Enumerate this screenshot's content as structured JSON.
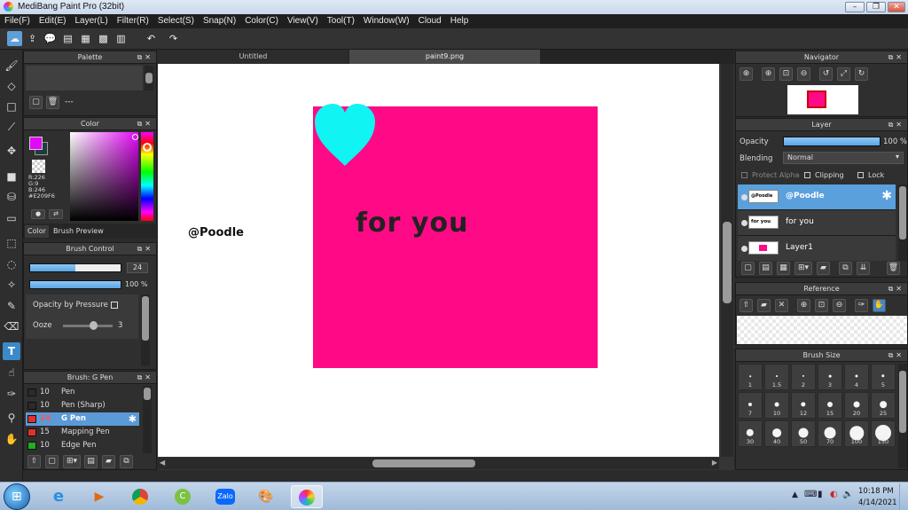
{
  "window": {
    "title": "MediBang Paint Pro (32bit)",
    "min": "–",
    "restore": "❐",
    "close": "✕"
  },
  "menu": [
    "File(F)",
    "Edit(E)",
    "Layer(L)",
    "Filter(R)",
    "Select(S)",
    "Snap(N)",
    "Color(C)",
    "View(V)",
    "Tool(T)",
    "Window(W)",
    "Cloud",
    "Help"
  ],
  "toolbar_icons": [
    "cloud-icon",
    "share-icon",
    "chat-icon",
    "comment-icon",
    "document-icon",
    "grid-icon",
    "layout-icon",
    "undo-icon",
    "redo-icon"
  ],
  "tools": [
    "brush",
    "eraser",
    "dot-square",
    "brush-stroke",
    "move",
    "fill-rect",
    "bucket",
    "gradient",
    "select-rect",
    "lasso",
    "magic-wand",
    "select-pen",
    "select-eraser",
    "text",
    "operation",
    "eyedropper",
    "pen-pick",
    "hand"
  ],
  "palette": {
    "title": "Palette",
    "status": "---"
  },
  "color": {
    "title": "Color",
    "r": "R:226",
    "g": "G:9",
    "b": "B:246",
    "hex": "#E209F6",
    "fg": "#E209F6",
    "bg": "#1e3d3d",
    "tab_color": "Color",
    "tab_preview": "Brush Preview"
  },
  "brush_control": {
    "title": "Brush Control",
    "size": "24",
    "size_frac": 0.5,
    "opacity": "100 %",
    "opacity_frac": 1.0,
    "opacity_pressure": "Opacity by Pressure",
    "ooze_label": "Ooze",
    "ooze": "3"
  },
  "brush_panel": {
    "title": "Brush: G Pen",
    "items": [
      {
        "size": "10",
        "name": "Pen",
        "color": "#2a2a2a"
      },
      {
        "size": "10",
        "name": "Pen (Sharp)",
        "color": "#2a2a2a"
      },
      {
        "size": "24",
        "name": "G Pen",
        "color": "#e03030"
      },
      {
        "size": "15",
        "name": "Mapping Pen",
        "color": "#e03030"
      },
      {
        "size": "10",
        "name": "Edge Pen",
        "color": "#20b020"
      }
    ]
  },
  "tabs": [
    "Untitled",
    "paint9.png"
  ],
  "canvas": {
    "watermark": "@Poodle",
    "text": "for you",
    "bg_color": "#fe0a86",
    "heart_color": "#10f4f4"
  },
  "navigator": {
    "title": "Navigator"
  },
  "layer": {
    "title": "Layer",
    "opacity_label": "Opacity",
    "opacity": "100 %",
    "opacity_frac": 1.0,
    "blending_label": "Blending",
    "blending": "Normal",
    "protect_alpha": "Protect Alpha",
    "clipping": "Clipping",
    "lock": "Lock",
    "items": [
      {
        "name": "@Poodle",
        "thumb": "@Poodle"
      },
      {
        "name": "for you",
        "thumb": "for you"
      },
      {
        "name": "Layer1",
        "thumb": ""
      }
    ]
  },
  "reference": {
    "title": "Reference"
  },
  "brush_size": {
    "title": "Brush Size",
    "sizes": [
      "1",
      "1.5",
      "2",
      "3",
      "4",
      "5",
      "7",
      "10",
      "12",
      "15",
      "20",
      "25",
      "30",
      "40",
      "50",
      "70",
      "100",
      "150"
    ]
  },
  "taskbar": {
    "time": "10:18 PM",
    "date": "4/14/2021",
    "zalo": "Zalo"
  }
}
